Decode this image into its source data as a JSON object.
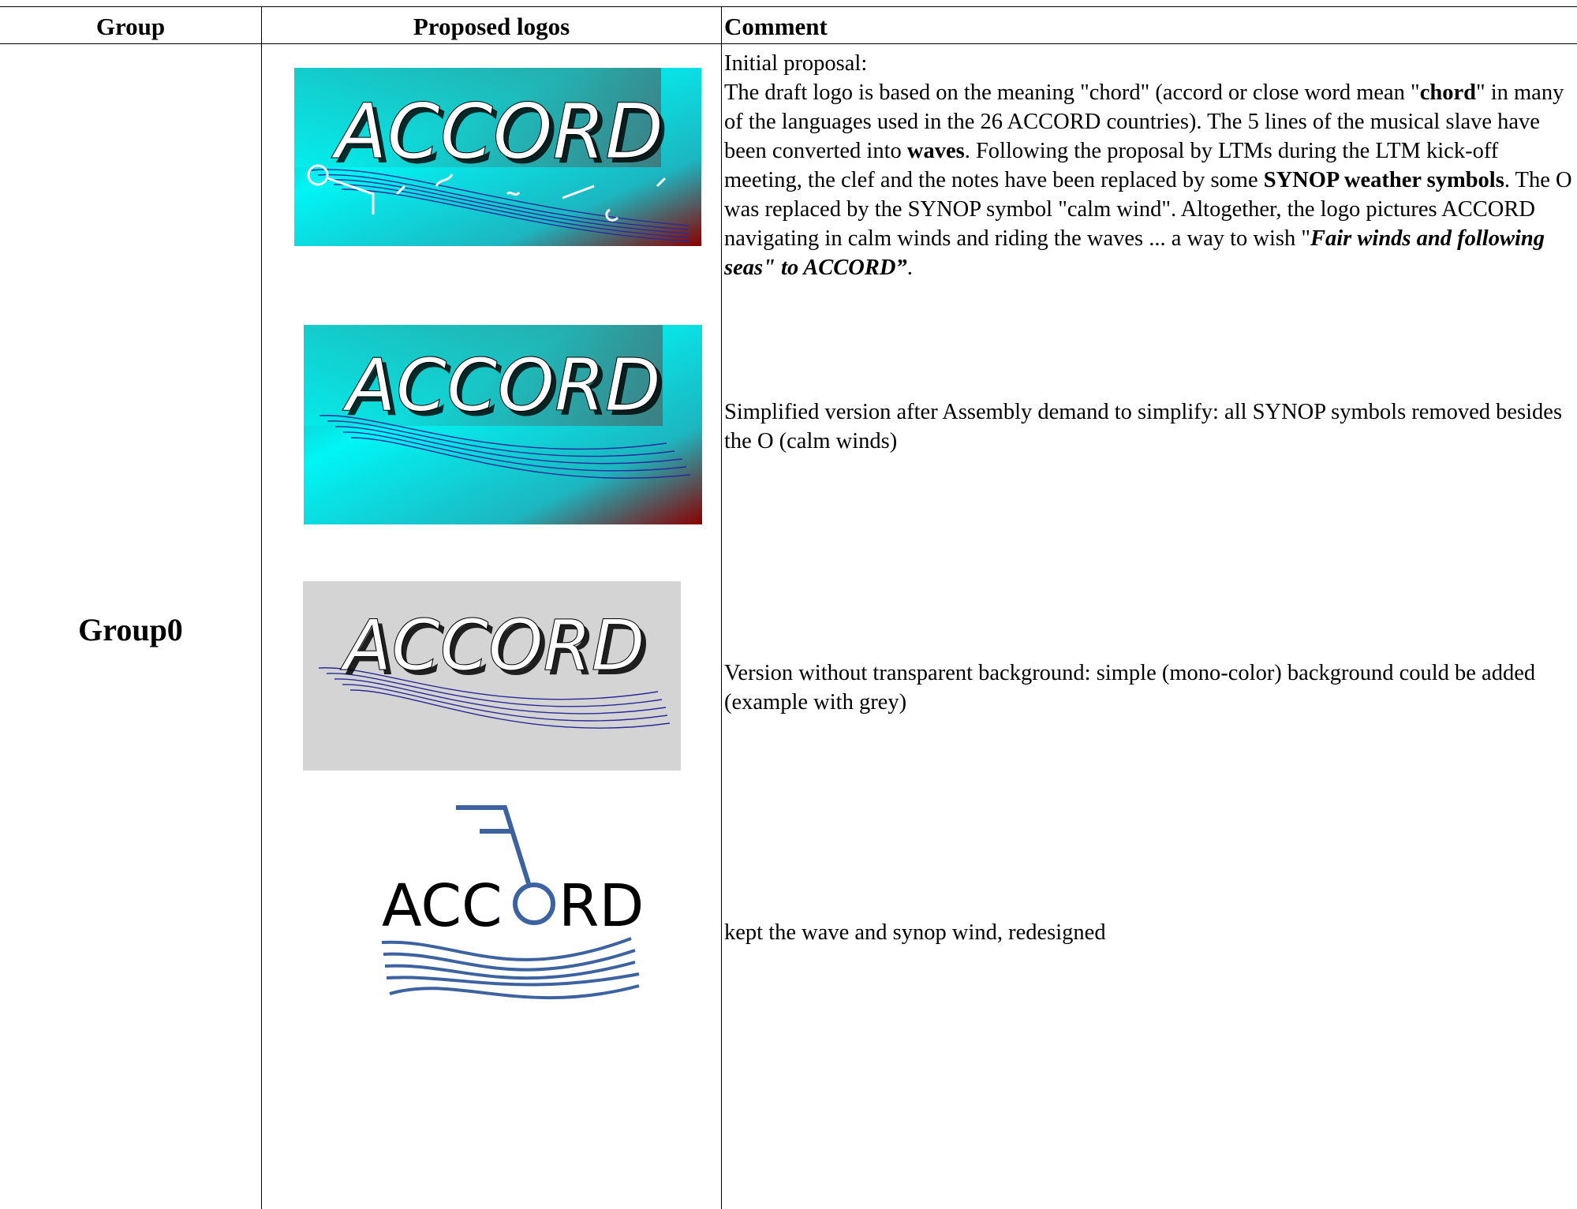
{
  "table": {
    "headers": {
      "group": "Group",
      "logos": "Proposed logos",
      "comment": "Comment"
    },
    "rows": [
      {
        "group": "Group0"
      }
    ]
  },
  "logos": [
    {
      "text": "ACCORD",
      "background": "cyan-gradient-with-synop-symbols",
      "comment": {
        "line0": "Initial proposal:",
        "p1": "The draft logo is based on the meaning \"chord\" (accord or close word mean \"",
        "b1": "chord",
        "p2": "\" in many of the languages used in the 26 ACCORD countries). The 5 lines of the musical slave have been converted into ",
        "b2": "waves",
        "p3": ". Following the proposal by LTMs during the LTM kick-off meeting, the clef and the notes have been replaced by some ",
        "b3": "SYNOP weather symbols",
        "p4": ". The O was replaced by the SYNOP symbol \"calm wind\". Altogether, the logo pictures ACCORD navigating in calm winds and riding the waves ... a way to wish \"",
        "bi": "Fair winds and following seas\" to ACCORD”",
        "p5": "."
      }
    },
    {
      "text": "ACCORD",
      "background": "cyan-gradient",
      "comment": "Simplified version after Assembly demand to simplify: all SYNOP symbols removed besides the O (calm winds)"
    },
    {
      "text": "ACCORD",
      "background": "grey",
      "comment": "Version without transparent background: simple (mono-color) background could be added (example with grey)"
    },
    {
      "text": "ACCORD",
      "background": "white",
      "comment": "kept the wave and synop wind, redesigned"
    }
  ],
  "colors": {
    "cyan": "#00f5f5",
    "dark_red": "#8a0000",
    "wave_blue": "#2a2a9a",
    "logo4_blue": "#3d62a0",
    "grey_bg": "#d4d4d4"
  }
}
